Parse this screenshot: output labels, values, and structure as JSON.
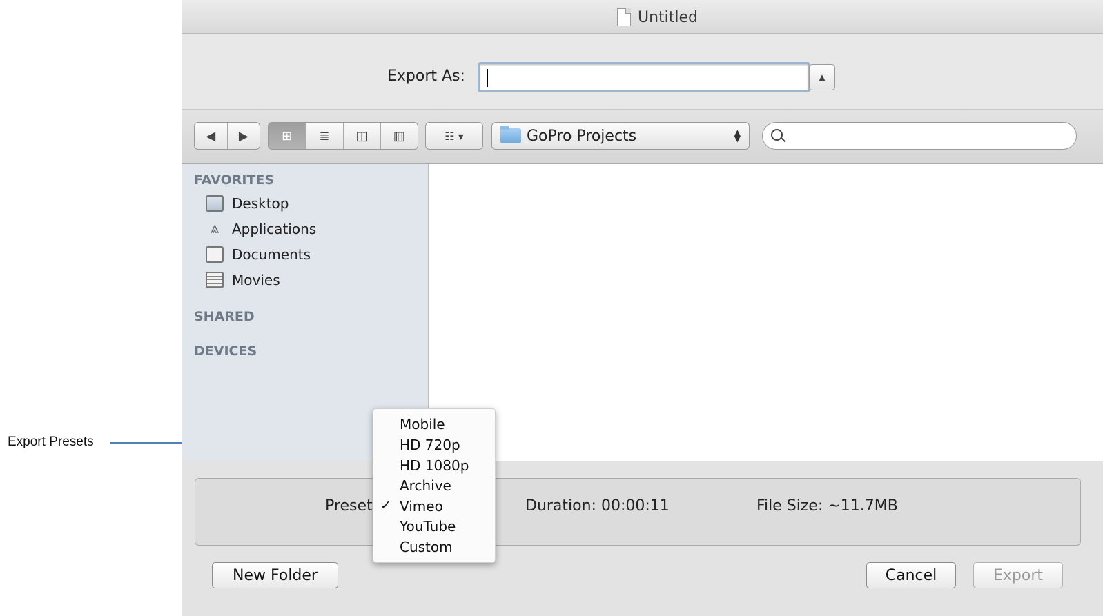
{
  "annotation": {
    "label": "Export Presets"
  },
  "window": {
    "title": "Untitled"
  },
  "export": {
    "label": "Export As:",
    "value": ""
  },
  "toolbar": {
    "back_icon": "◀",
    "forward_icon": "▶",
    "view_icon_glyph": "⊞",
    "view_list_glyph": "≣",
    "view_column_glyph": "◫",
    "view_coverflow_glyph": "▥",
    "arrange_glyph": "☷ ▾",
    "location": "GoPro Projects",
    "search_placeholder": ""
  },
  "sidebar": {
    "favorites_header": "FAVORITES",
    "favorites": [
      {
        "label": "Desktop",
        "icon": "desktop-icon"
      },
      {
        "label": "Applications",
        "icon": "applications-icon"
      },
      {
        "label": "Documents",
        "icon": "documents-icon"
      },
      {
        "label": "Movies",
        "icon": "movies-icon"
      }
    ],
    "shared_header": "SHARED",
    "devices_header": "DEVICES"
  },
  "options": {
    "preset_label": "Preset",
    "duration": "Duration:  00:00:11",
    "file_size": "File Size:  ~11.7MB"
  },
  "preset_menu": {
    "items": [
      "Mobile",
      "HD 720p",
      "HD 1080p",
      "Archive",
      "Vimeo",
      "YouTube",
      "Custom"
    ],
    "selected": "Vimeo",
    "check": "✓"
  },
  "buttons": {
    "new_folder": "New Folder",
    "cancel": "Cancel",
    "export": "Export"
  },
  "colors": {
    "arrow": "#4f81bd",
    "sidebar": "#e1e6ed",
    "selection_view": "#9e9e9e"
  }
}
